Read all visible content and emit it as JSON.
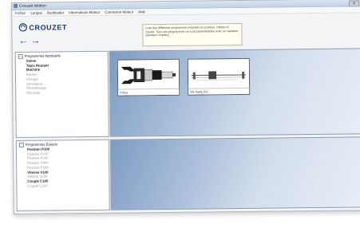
{
  "window": {
    "title": "Crouzet Motion",
    "close_label": "X"
  },
  "menu": [
    {
      "label": "Fichier"
    },
    {
      "label": "Langue"
    },
    {
      "label": "Bootloader"
    },
    {
      "label": "Informations Moteur"
    },
    {
      "label": "Connexion Moteur"
    },
    {
      "label": "Aide"
    }
  ],
  "logo": {
    "text": "CROUZET",
    "icon": "crouzet-swirl-icon"
  },
  "nav": {
    "back_icon": "←",
    "forward_icon": "→"
  },
  "info": {
    "text": "Liste des différents programmes exportés en position, vitesse et couple. Tous ces programmes ne sont paramétrables avec un variateur (situation requise)."
  },
  "programs_applicatifs": {
    "root_label": "Programmes Applicatifs",
    "expander": "−",
    "items": [
      {
        "label": "Vanne",
        "enabled": true
      },
      {
        "label": "Tapis Roulant",
        "enabled": true
      },
      {
        "label": "Machine",
        "enabled": true
      },
      {
        "label": "Bouton",
        "enabled": false
      },
      {
        "label": "Dosage",
        "enabled": false
      },
      {
        "label": "Ventilateur",
        "enabled": false
      },
      {
        "label": "Remplissage",
        "enabled": false
      },
      {
        "label": "Découpe",
        "enabled": false
      }
    ]
  },
  "programs_experts": {
    "root_label": "Programmes Experts",
    "expander": "−",
    "items": [
      {
        "label": "Position P100",
        "enabled": true
      },
      {
        "label": "Position P200",
        "enabled": false
      },
      {
        "label": "Position P300",
        "enabled": false
      },
      {
        "label": "Position P400",
        "enabled": false
      },
      {
        "label": "Position P500",
        "enabled": false
      },
      {
        "label": "Vitesse V100",
        "enabled": true
      },
      {
        "label": "Vitesse V200",
        "enabled": false
      },
      {
        "label": "Couple C100",
        "enabled": true
      },
      {
        "label": "Couple C200",
        "enabled": false
      }
    ]
  },
  "thumbnails": [
    {
      "caption": "Pince"
    },
    {
      "caption": "Vis Sans Fin"
    }
  ]
}
